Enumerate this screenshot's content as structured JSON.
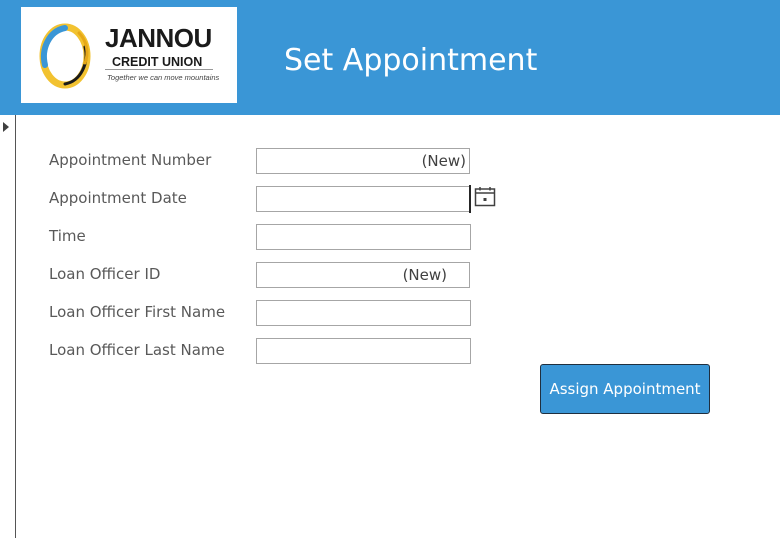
{
  "header": {
    "title": "Set Appointment",
    "logo": {
      "name": "JANNOU",
      "subtitle": "CREDIT UNION",
      "tagline": "Together we can move mountains"
    }
  },
  "form": {
    "fields": [
      {
        "label": "Appointment Number",
        "value": "(New)"
      },
      {
        "label": "Appointment Date",
        "value": ""
      },
      {
        "label": "Time",
        "value": ""
      },
      {
        "label": "Loan Officer ID",
        "value": "(New)"
      },
      {
        "label": "Loan Officer First Name",
        "value": ""
      },
      {
        "label": "Loan Officer Last Name",
        "value": ""
      }
    ],
    "assign_button_label": "Assign Appointment"
  },
  "colors": {
    "header_background": "#3a96d6",
    "button_background": "#3a96d6",
    "label_text": "#595959"
  }
}
